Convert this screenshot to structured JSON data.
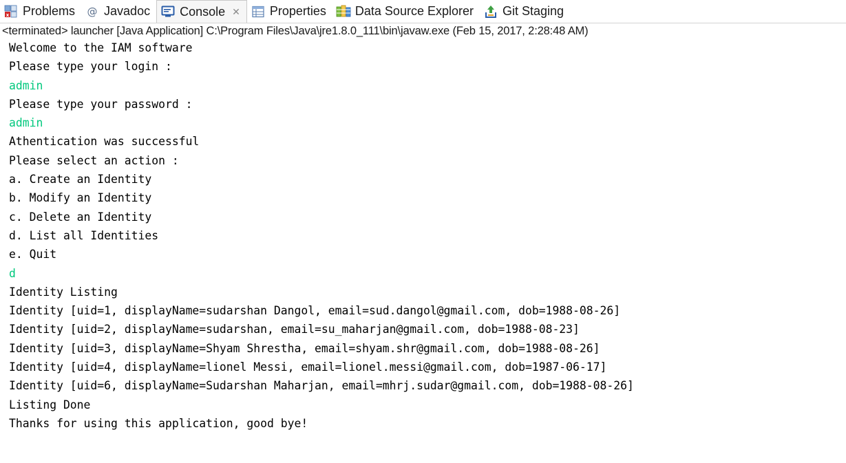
{
  "tabs": [
    {
      "id": "problems",
      "label": "Problems",
      "icon": "problems-icon",
      "active": false
    },
    {
      "id": "javadoc",
      "label": "Javadoc",
      "icon": "at-icon",
      "active": false
    },
    {
      "id": "console",
      "label": "Console",
      "icon": "console-icon",
      "active": true,
      "close_glyph": "✕"
    },
    {
      "id": "properties",
      "label": "Properties",
      "icon": "properties-icon",
      "active": false
    },
    {
      "id": "datasource",
      "label": "Data Source Explorer",
      "icon": "data-source-icon",
      "active": false
    },
    {
      "id": "gitstaging",
      "label": "Git Staging",
      "icon": "git-staging-icon",
      "active": false
    }
  ],
  "console": {
    "status": "<terminated> launcher [Java Application] C:\\Program Files\\Java\\jre1.8.0_111\\bin\\javaw.exe (Feb 15, 2017, 2:28:48 AM)",
    "lines": [
      {
        "text": "Welcome to the IAM software",
        "input": false
      },
      {
        "text": "Please type your login :",
        "input": false
      },
      {
        "text": "admin",
        "input": true
      },
      {
        "text": "Please type your password :",
        "input": false
      },
      {
        "text": "admin",
        "input": true
      },
      {
        "text": "Athentication was successful",
        "input": false
      },
      {
        "text": "Please select an action :",
        "input": false
      },
      {
        "text": "a. Create an Identity",
        "input": false
      },
      {
        "text": "b. Modify an Identity",
        "input": false
      },
      {
        "text": "c. Delete an Identity",
        "input": false
      },
      {
        "text": "d. List all Identities",
        "input": false
      },
      {
        "text": "e. Quit",
        "input": false
      },
      {
        "text": "d",
        "input": true
      },
      {
        "text": "Identity Listing",
        "input": false
      },
      {
        "text": "Identity [uid=1, displayName=sudarshan Dangol, email=sud.dangol@gmail.com, dob=1988-08-26]",
        "input": false
      },
      {
        "text": "Identity [uid=2, displayName=sudarshan, email=su_maharjan@gmail.com, dob=1988-08-23]",
        "input": false
      },
      {
        "text": "Identity [uid=3, displayName=Shyam Shrestha, email=shyam.shr@gmail.com, dob=1988-08-26]",
        "input": false
      },
      {
        "text": "Identity [uid=4, displayName=lionel Messi, email=lionel.messi@gmail.com, dob=1987-06-17]",
        "input": false
      },
      {
        "text": "Identity [uid=6, displayName=Sudarshan Maharjan, email=mhrj.sudar@gmail.com, dob=1988-08-26]",
        "input": false
      },
      {
        "text": "Listing Done",
        "input": false
      },
      {
        "text": "Thanks for using this application, good bye!",
        "input": false
      }
    ]
  },
  "colors": {
    "input_text": "#00c87d",
    "output_text": "#000000"
  }
}
